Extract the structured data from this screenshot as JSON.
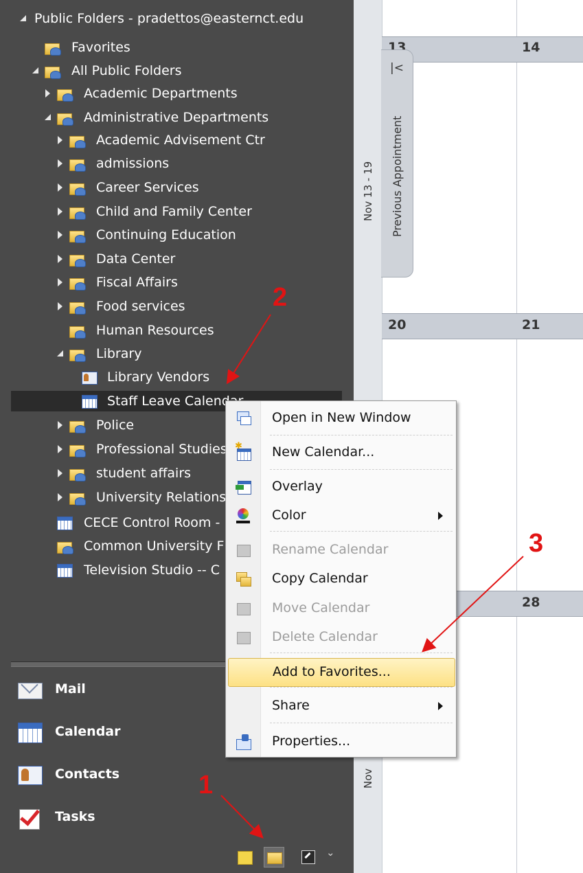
{
  "nav": {
    "tree": [
      {
        "label": "Public Folders - pradettos@easternct.edu",
        "tri": "exp",
        "icon": "none",
        "indent": 0
      },
      {
        "label": "Favorites",
        "tri": "none",
        "icon": "folder",
        "indent": 1
      },
      {
        "label": "All Public Folders",
        "tri": "exp",
        "icon": "folder",
        "indent": 1
      },
      {
        "label": "Academic Departments",
        "tri": "col",
        "icon": "folder",
        "indent": 2
      },
      {
        "label": "Administrative Departments",
        "tri": "exp",
        "icon": "folder",
        "indent": 2
      },
      {
        "label": "Academic Advisement Ctr",
        "tri": "col",
        "icon": "folder",
        "indent": 3
      },
      {
        "label": "admissions",
        "tri": "col",
        "icon": "folder",
        "indent": 3
      },
      {
        "label": "Career Services",
        "tri": "col",
        "icon": "folder",
        "indent": 3
      },
      {
        "label": "Child and Family Center",
        "tri": "col",
        "icon": "folder",
        "indent": 3
      },
      {
        "label": "Continuing Education",
        "tri": "col",
        "icon": "folder",
        "indent": 3
      },
      {
        "label": "Data Center",
        "tri": "col",
        "icon": "folder",
        "indent": 3
      },
      {
        "label": "Fiscal Affairs",
        "tri": "col",
        "icon": "folder",
        "indent": 3
      },
      {
        "label": "Food services",
        "tri": "col",
        "icon": "folder",
        "indent": 3
      },
      {
        "label": "Human Resources",
        "tri": "none",
        "icon": "folder",
        "indent": 3
      },
      {
        "label": "Library",
        "tri": "exp",
        "icon": "folder",
        "indent": 3
      },
      {
        "label": "Library Vendors",
        "tri": "none",
        "icon": "contact",
        "indent": 4
      },
      {
        "label": "Staff Leave Calendar",
        "tri": "none",
        "icon": "calendar",
        "indent": 4,
        "selected": true
      },
      {
        "label": "Police",
        "tri": "col",
        "icon": "folder",
        "indent": 3
      },
      {
        "label": "Professional Studies",
        "tri": "col",
        "icon": "folder",
        "indent": 3
      },
      {
        "label": "student affairs",
        "tri": "col",
        "icon": "folder",
        "indent": 3
      },
      {
        "label": "University Relations",
        "tri": "col",
        "icon": "folder",
        "indent": 3
      },
      {
        "label": "CECE Control Room -",
        "tri": "none",
        "icon": "calendar",
        "indent": 2
      },
      {
        "label": "Common University F",
        "tri": "none",
        "icon": "folder",
        "indent": 2
      },
      {
        "label": "Television Studio -- C",
        "tri": "none",
        "icon": "calendar",
        "indent": 2
      }
    ],
    "modules": [
      {
        "label": "Mail",
        "icon": "mail-icon"
      },
      {
        "label": "Calendar",
        "icon": "calendar-icon"
      },
      {
        "label": "Contacts",
        "icon": "contacts-icon"
      },
      {
        "label": "Tasks",
        "icon": "tasks-icon"
      }
    ],
    "mini_chevron": "⌄"
  },
  "calendar": {
    "rows": [
      {
        "days": [
          "13",
          "14"
        ]
      },
      {
        "days": [
          "20",
          "21"
        ]
      },
      {
        "days": [
          "",
          "28"
        ]
      }
    ],
    "week_labels": [
      "Nov 13 - 19",
      "Nov"
    ],
    "prev_appointment": {
      "glyph": "|<",
      "label": "Previous Appointment"
    }
  },
  "context_menu": {
    "items": [
      {
        "label": "Open in New Window",
        "icon": "new-window-icon",
        "disabled": false,
        "submenu": false
      },
      {
        "label": "New Calendar...",
        "icon": "new-calendar-icon",
        "disabled": false,
        "submenu": false
      },
      {
        "label": "Overlay",
        "icon": "overlay-icon",
        "disabled": false,
        "submenu": false
      },
      {
        "label": "Color",
        "icon": "color-icon",
        "disabled": false,
        "submenu": true
      },
      {
        "label": "Rename Calendar",
        "icon": "rename-icon",
        "disabled": true,
        "submenu": false
      },
      {
        "label": "Copy Calendar",
        "icon": "copy-icon",
        "disabled": false,
        "submenu": false
      },
      {
        "label": "Move Calendar",
        "icon": "move-icon",
        "disabled": true,
        "submenu": false
      },
      {
        "label": "Delete Calendar",
        "icon": "delete-icon",
        "disabled": true,
        "submenu": false
      },
      {
        "label": "Add to Favorites...",
        "icon": "none",
        "disabled": false,
        "submenu": false,
        "highlighted": true
      },
      {
        "label": "Share",
        "icon": "none",
        "disabled": false,
        "submenu": true
      },
      {
        "label": "Properties...",
        "icon": "properties-icon",
        "disabled": false,
        "submenu": false
      }
    ]
  },
  "annotations": [
    "1",
    "2",
    "3"
  ],
  "colors": {
    "annotation": "#e11414",
    "nav_bg": "#4a4a4a",
    "highlight": "#fde184"
  }
}
